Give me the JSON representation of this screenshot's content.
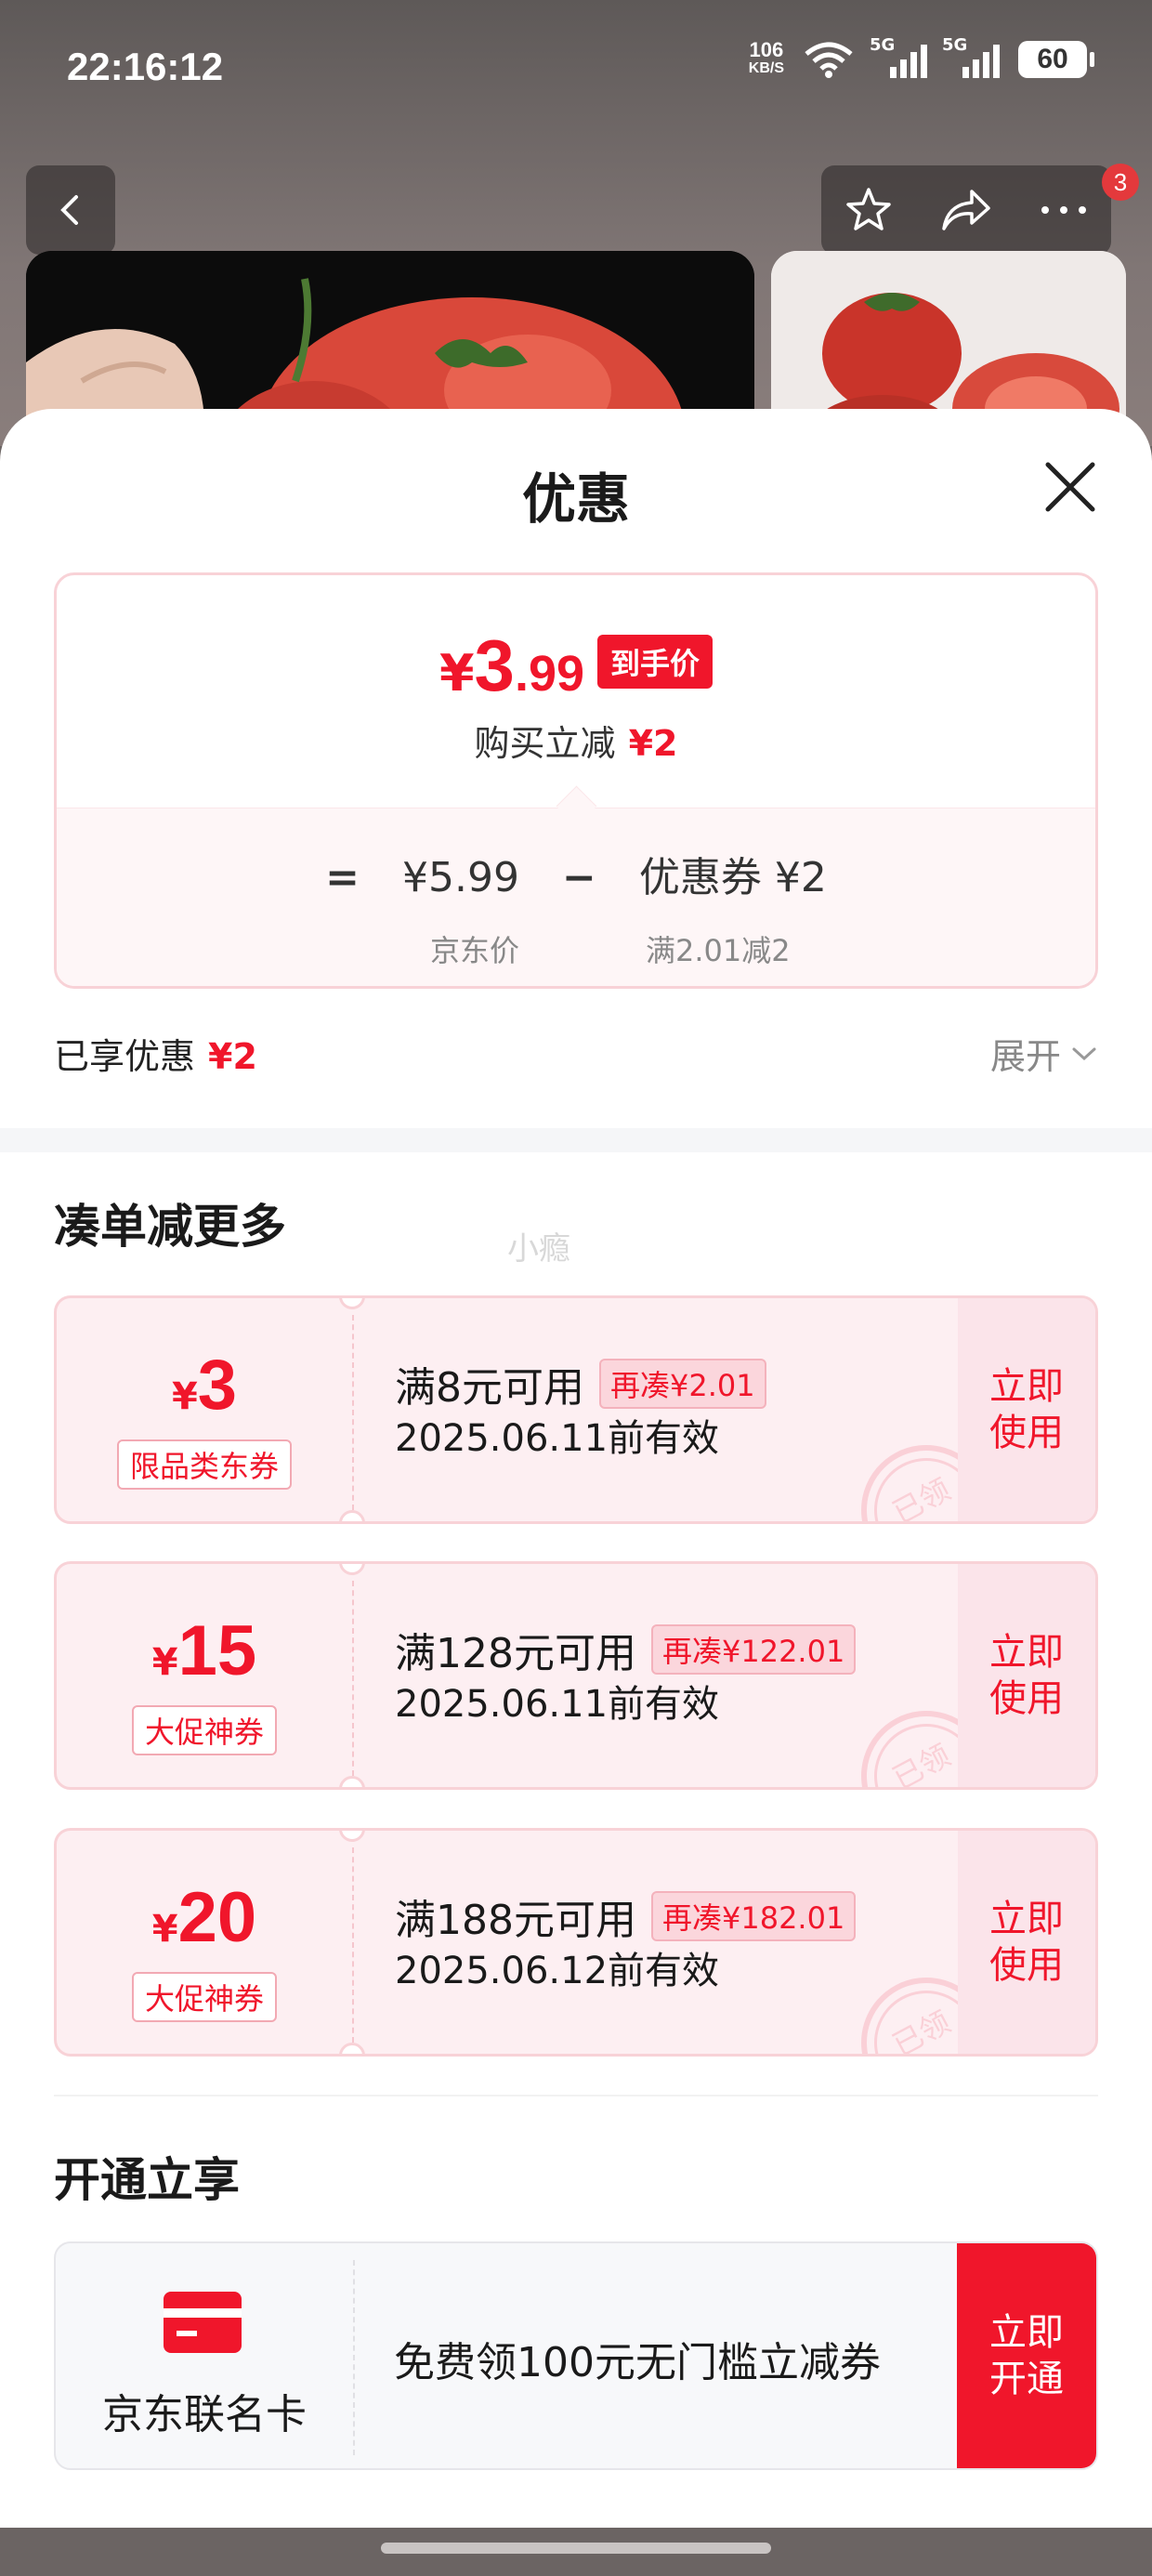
{
  "status_bar": {
    "time": "22:16:12",
    "net_speed": "106",
    "net_unit": "KB/S",
    "sim1": "5G",
    "sim2": "5G",
    "battery": "60"
  },
  "header": {
    "cart_badge": "3"
  },
  "sheet": {
    "title": "优惠",
    "price": {
      "currency": "¥",
      "int": "3",
      "decimal": ".99",
      "tag": "到手价",
      "reduce_label": "购买立减",
      "reduce_amount": "¥2",
      "eq": "=",
      "base_price": "¥5.99",
      "minus": "−",
      "coupon_part": "优惠券 ¥2",
      "base_label": "京东价",
      "coupon_label": "满2.01减2"
    },
    "enjoyed_label": "已享优惠",
    "enjoyed_amount": "¥2",
    "expand_label": "展开"
  },
  "more_section": {
    "title": "凑单减更多",
    "watermark": "小瘾",
    "coupons": [
      {
        "currency": "¥",
        "amount": "3",
        "type": "限品类东券",
        "condition": "满8元可用",
        "more": "再凑¥2.01",
        "valid": "2025.06.11前有效",
        "action": "立即\n使用",
        "stamp": "已领"
      },
      {
        "currency": "¥",
        "amount": "15",
        "type": "大促神券",
        "condition": "满128元可用",
        "more": "再凑¥122.01",
        "valid": "2025.06.11前有效",
        "action": "立即\n使用",
        "stamp": "已领"
      },
      {
        "currency": "¥",
        "amount": "20",
        "type": "大促神券",
        "condition": "满188元可用",
        "more": "再凑¥182.01",
        "valid": "2025.06.12前有效",
        "action": "立即\n使用",
        "stamp": "已领"
      }
    ]
  },
  "open_section": {
    "title": "开通立享",
    "card_name": "京东联名卡",
    "description": "免费领100元无门槛立减券",
    "action": "立即\n开通"
  },
  "colors": {
    "accent": "#f0162b",
    "coupon_bg": "#fdeff2",
    "border": "#f8d2d7"
  }
}
